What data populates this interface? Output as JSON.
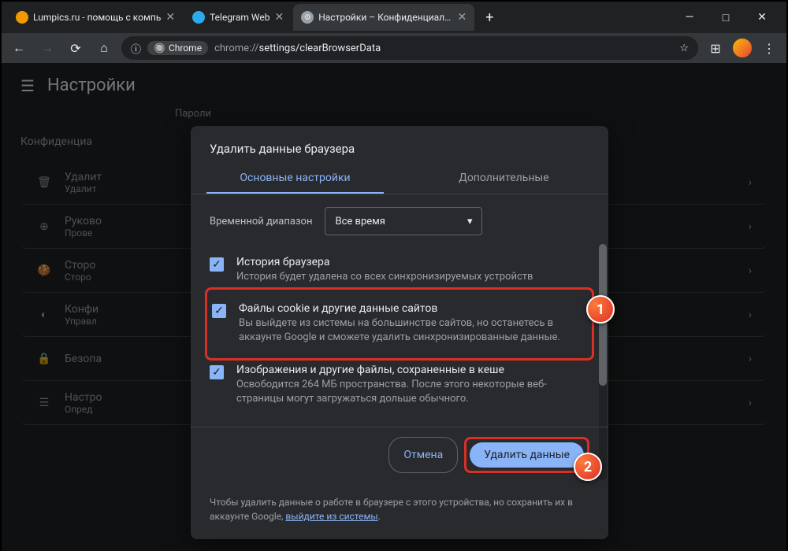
{
  "tabs": [
    {
      "label": "Lumpics.ru - помощь с компь",
      "favicon": "#f29900"
    },
    {
      "label": "Telegram Web",
      "favicon": "#2aabee"
    },
    {
      "label": "Настройки – Конфиденциальн",
      "favicon": "#9aa0a6",
      "active": true
    }
  ],
  "window": {
    "minimize": "—",
    "maximize": "□",
    "close": "✕"
  },
  "address": {
    "chip": "Chrome",
    "url_prefix": "chrome://",
    "url_path": "settings/clearBrowserData"
  },
  "page": {
    "title": "Настройки",
    "section": "Конфиденциа",
    "passwords_hint": "Пароли"
  },
  "bgitems": [
    {
      "icon": "🗑",
      "t1": "Удалит",
      "t2": "Удалит"
    },
    {
      "icon": "⊕",
      "t1": "Руково",
      "t2": "Прове"
    },
    {
      "icon": "🍪",
      "t1": "Сторо",
      "t2": "Сторо"
    },
    {
      "icon": "◐",
      "t1": "Конфи",
      "t2": "Управл"
    },
    {
      "icon": "🔒",
      "t1": "Безопа",
      "t2": ""
    },
    {
      "icon": "☰",
      "t1": "Настро",
      "t2": "Опред"
    }
  ],
  "dialog": {
    "title": "Удалить данные браузера",
    "tab_basic": "Основные настройки",
    "tab_advanced": "Дополнительные",
    "time_label": "Временной диапазон",
    "time_value": "Все время",
    "items": [
      {
        "title": "История браузера",
        "desc": "История будет удалена со всех синхронизируемых устройств"
      },
      {
        "title": "Файлы cookie и другие данные сайтов",
        "desc": "Вы выйдете из системы на большинстве сайтов, но останетесь в аккаунте Google и сможете удалить синхронизированные данные."
      },
      {
        "title": "Изображения и другие файлы, сохраненные в кеше",
        "desc": "Освободится 264 МБ пространства. После этого некоторые веб-страницы могут загружаться дольше обычного."
      }
    ],
    "cancel": "Отмена",
    "confirm": "Удалить данные",
    "note_prefix": "Чтобы удалить данные о работе в браузере с этого устройства, но сохранить их в аккаунте Google, ",
    "note_link": "выйдите из системы",
    "note_suffix": "."
  },
  "callouts": {
    "one": "1",
    "two": "2"
  }
}
